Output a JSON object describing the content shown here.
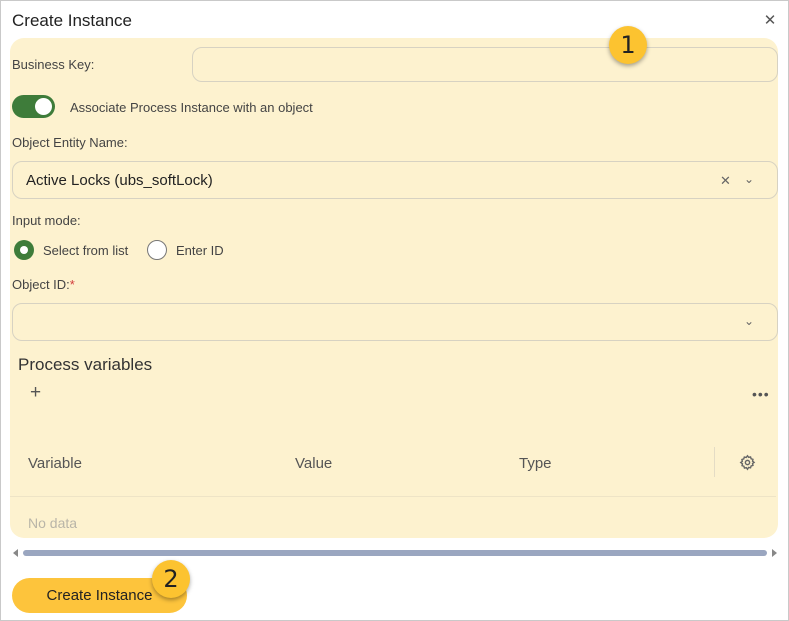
{
  "dialog": {
    "title": "Create Instance",
    "close_icon": "close-icon"
  },
  "form": {
    "business_key_label": "Business Key:",
    "business_key_value": "",
    "associate_label": "Associate Process Instance with an object",
    "associate_enabled": true,
    "object_entity_label": "Object Entity Name:",
    "object_entity_value": "Active Locks (ubs_softLock)",
    "input_mode_label": "Input mode:",
    "input_mode_options": [
      "Select from list",
      "Enter ID"
    ],
    "input_mode_selected": "Select from list",
    "object_id_label": "Object ID:",
    "object_id_required_mark": "*",
    "object_id_value": ""
  },
  "variables": {
    "title": "Process variables",
    "add_icon": "plus-icon",
    "more_icon": "more-horizontal-icon",
    "columns": [
      "Variable",
      "Value",
      "Type"
    ],
    "settings_icon": "gear-icon",
    "empty_text": "No data"
  },
  "footer": {
    "create_label": "Create Instance"
  },
  "annotations": [
    "1",
    "2"
  ],
  "colors": {
    "panel_bg": "#fdf2cf",
    "accent_green": "#3e7c3a",
    "primary_button": "#fdc43c",
    "badge_fill": "#fcc330"
  }
}
